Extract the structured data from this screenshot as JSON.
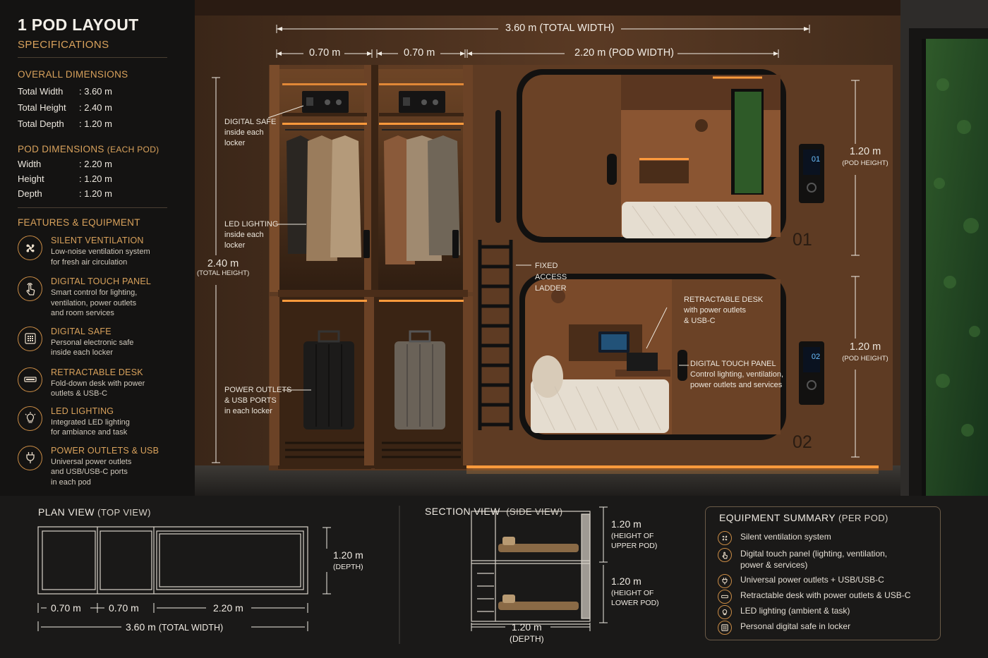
{
  "spec": {
    "title": "1 POD LAYOUT",
    "subtitle": "SPECIFICATIONS",
    "overall_heading": "OVERALL DIMENSIONS",
    "overall": [
      {
        "k": "Total Width",
        "v": ": 3.60 m"
      },
      {
        "k": "Total Height",
        "v": ": 2.40 m"
      },
      {
        "k": "Total Depth",
        "v": ": 1.20 m"
      }
    ],
    "pod_heading": "POD DIMENSIONS",
    "pod_heading_note": "(EACH POD)",
    "pod": [
      {
        "k": "Width",
        "v": ": 2.20 m"
      },
      {
        "k": "Height",
        "v": ": 1.20 m"
      },
      {
        "k": "Depth",
        "v": ": 1.20 m"
      }
    ],
    "features_heading": "FEATURES & EQUIPMENT",
    "features": [
      {
        "title": "SILENT VENTILATION",
        "desc": [
          "Low-noise ventilation system",
          "for fresh air circulation"
        ],
        "icon": "fan-icon"
      },
      {
        "title": "DIGITAL TOUCH PANEL",
        "desc": [
          "Smart control for lighting,",
          "ventilation, power outlets",
          "and room services"
        ],
        "icon": "touch-hand-icon"
      },
      {
        "title": "DIGITAL SAFE",
        "desc": [
          "Personal electronic safe",
          "inside each locker"
        ],
        "icon": "keypad-icon"
      },
      {
        "title": "RETRACTABLE DESK",
        "desc": [
          "Fold-down desk with power",
          "outlets & USB-C"
        ],
        "icon": "desk-icon"
      },
      {
        "title": "LED LIGHTING",
        "desc": [
          "Integrated LED lighting",
          "for ambiance and task"
        ],
        "icon": "bulb-icon"
      },
      {
        "title": "POWER OUTLETS & USB",
        "desc": [
          "Universal power outlets",
          "and USB/USB-C ports",
          "in each pod"
        ],
        "icon": "plug-icon"
      }
    ]
  },
  "hero": {
    "dim_total_width": "3.60 m",
    "dim_total_width_note": "(TOTAL WIDTH)",
    "dim_locker1": "0.70 m",
    "dim_locker2": "0.70 m",
    "dim_pod_width": "2.20 m",
    "dim_pod_width_note": "(POD WIDTH)",
    "dim_total_height": "2.40 m",
    "dim_total_height_note": "(TOTAL HEIGHT)",
    "dim_pod1_height": "1.20 m",
    "dim_pod1_height_note": "(POD HEIGHT)",
    "dim_pod2_height": "1.20 m",
    "dim_pod2_height_note": "(POD HEIGHT)",
    "ann_safe": [
      "DIGITAL SAFE",
      "inside each",
      "locker"
    ],
    "ann_led": [
      "LED LIGHTING",
      "inside each",
      "locker"
    ],
    "ann_power": [
      "POWER OUTLETS",
      "& USB PORTS",
      "in each locker"
    ],
    "ann_ladder": [
      "FIXED",
      "ACCESS",
      "LADDER"
    ],
    "ann_desk": [
      "RETRACTABLE DESK",
      "with power outlets",
      "& USB-C"
    ],
    "ann_panel": [
      "DIGITAL TOUCH PANEL",
      "Control lighting, ventilation,",
      "power outlets and services"
    ],
    "pod1_number": "01",
    "pod2_number": "02",
    "panel1_display": "01",
    "panel2_display": "02",
    "colors": {
      "wood": "#6b4226",
      "wood_dark": "#3d2616",
      "led": "#ff9a3c",
      "frame": "#121110"
    }
  },
  "plan": {
    "title": "PLAN VIEW",
    "title_note": "(TOP VIEW)",
    "depth": "1.20 m",
    "depth_note": "(DEPTH)",
    "w1": "0.70 m",
    "w2": "0.70 m",
    "w3": "2.20 m",
    "total": "3.60 m",
    "total_note": "(TOTAL WIDTH)"
  },
  "section": {
    "title": "SECTION VIEW",
    "title_note": "(SIDE VIEW)",
    "upper": "1.20 m",
    "upper_note": [
      "(HEIGHT OF",
      "UPPER POD)"
    ],
    "lower": "1.20 m",
    "lower_note": [
      "(HEIGHT OF",
      "LOWER POD)"
    ],
    "depth": "1.20 m",
    "depth_note": "(DEPTH)"
  },
  "equipment": {
    "title": "EQUIPMENT SUMMARY",
    "title_note": "(PER POD)",
    "items": [
      {
        "text": [
          "Silent ventilation system"
        ],
        "icon": "fan-icon"
      },
      {
        "text": [
          "Digital touch panel (lighting, ventilation,",
          "power & services)"
        ],
        "icon": "touch-hand-icon"
      },
      {
        "text": [
          "Universal power outlets + USB/USB-C"
        ],
        "icon": "plug-icon"
      },
      {
        "text": [
          "Retractable desk with power outlets & USB-C"
        ],
        "icon": "desk-icon"
      },
      {
        "text": [
          "LED lighting (ambient & task)"
        ],
        "icon": "bulb-icon"
      },
      {
        "text": [
          "Personal digital safe in locker"
        ],
        "icon": "keypad-icon"
      }
    ]
  }
}
